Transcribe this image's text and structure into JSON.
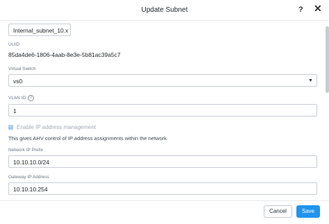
{
  "dialog": {
    "title": "Update Subnet",
    "help_icon": "?",
    "close_icon": "✕"
  },
  "form": {
    "name_value": "Internal_subnet_10.x",
    "uuid_label": "UUID",
    "uuid_value": "85da4de6-1806-4aab-8e3e-5b81ac39a5c7",
    "virtual_switch_label": "Virtual Switch",
    "virtual_switch_value": "vs0",
    "vlan_label": "VLAN ID",
    "vlan_value": "1",
    "ipam_label": "Enable IP address management",
    "ipam_checked": true,
    "ipam_help": "This gives AHV control of IP address assignments within the network.",
    "prefix_label": "Network IP Prefix",
    "prefix_value": "10.10.10.0/24",
    "gateway_label": "Gateway IP Address",
    "gateway_value": "10.10.10.254"
  },
  "footer": {
    "cancel_label": "Cancel",
    "save_label": "Save"
  },
  "colors": {
    "accent": "#2194ed",
    "checkbox_disabled": "#a9c7e8"
  },
  "icons": [
    "help-icon",
    "close-icon",
    "chevron-down-icon",
    "info-icon",
    "check-icon"
  ]
}
